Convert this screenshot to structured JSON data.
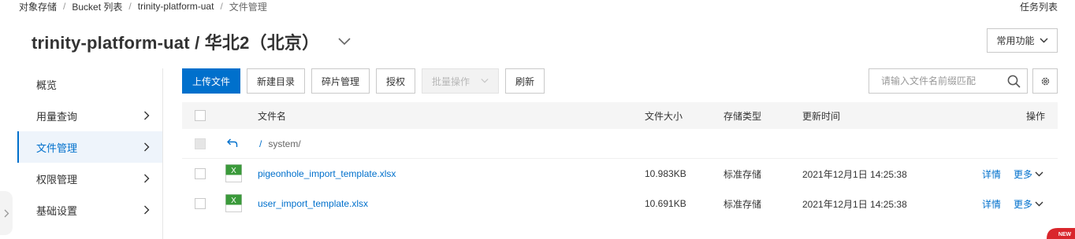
{
  "breadcrumb": {
    "items": [
      "对象存储",
      "Bucket 列表",
      "trinity-platform-uat",
      "文件管理"
    ],
    "separator": "/"
  },
  "header": {
    "title": "trinity-platform-uat / 华北2（北京）",
    "task_list": "任务列表",
    "common_functions": "常用功能"
  },
  "sidebar": {
    "items": [
      {
        "label": "概览",
        "has_chevron": false,
        "active": false
      },
      {
        "label": "用量查询",
        "has_chevron": true,
        "active": false
      },
      {
        "label": "文件管理",
        "has_chevron": true,
        "active": true
      },
      {
        "label": "权限管理",
        "has_chevron": true,
        "active": false
      },
      {
        "label": "基础设置",
        "has_chevron": true,
        "active": false
      }
    ]
  },
  "toolbar": {
    "upload": "上传文件",
    "new_folder": "新建目录",
    "fragments": "碎片管理",
    "authorize": "授权",
    "batch": "批量操作",
    "refresh": "刷新"
  },
  "search": {
    "placeholder": "请输入文件名前缀匹配"
  },
  "table": {
    "headers": {
      "name": "文件名",
      "size": "文件大小",
      "storage_type": "存储类型",
      "updated": "更新时间",
      "actions": "操作"
    },
    "parent": {
      "slash": "/",
      "path": "system/"
    },
    "rows": [
      {
        "name": "pigeonhole_import_template.xlsx",
        "size": "10.983KB",
        "storage_type": "标准存储",
        "updated": "2021年12月1日 14:25:38",
        "detail": "详情",
        "more": "更多"
      },
      {
        "name": "user_import_template.xlsx",
        "size": "10.691KB",
        "storage_type": "标准存储",
        "updated": "2021年12月1日 14:25:38",
        "detail": "详情",
        "more": "更多"
      }
    ]
  },
  "file_icon_letter": "X",
  "new_badge": "NEW",
  "colors": {
    "accent": "#0070cc",
    "active_bg": "#eef4fb",
    "excel_green": "#3a9a3a",
    "badge_red": "#d9262c"
  }
}
